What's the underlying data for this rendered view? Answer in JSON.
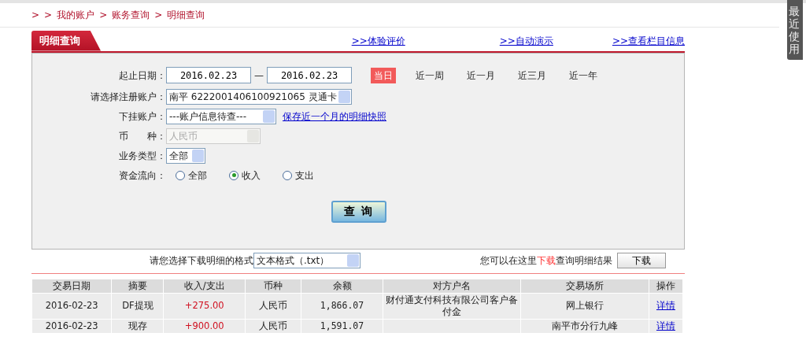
{
  "breadcrumb": {
    "prefix": ">",
    "separator": ">",
    "items": [
      "我的账户",
      "账务查询",
      "明细查询"
    ]
  },
  "side_tab": {
    "label": "最近使用"
  },
  "panel_tab": {
    "title": "明细查询"
  },
  "top_links": [
    {
      "arrow": ">>",
      "label": "体验评价"
    },
    {
      "arrow": ">>",
      "label": "自动演示"
    },
    {
      "arrow": ">>",
      "label": "查看栏目信息"
    }
  ],
  "form": {
    "date_label": "起止日期：",
    "date_from": "2016.02.23",
    "date_sep": "—",
    "date_to": "2016.02.23",
    "ranges": [
      {
        "label": "当日",
        "selected": true
      },
      {
        "label": "近一周",
        "selected": false
      },
      {
        "label": "近一月",
        "selected": false
      },
      {
        "label": "近三月",
        "selected": false
      },
      {
        "label": "近一年",
        "selected": false
      }
    ],
    "account_label": "请选择注册账户：",
    "account_value": "南平  6222001406100921065 灵通卡",
    "sub_label": "下挂账户：",
    "sub_value": "---账户信息待查---",
    "snapshot_link": "保存近一个月的明细快照",
    "currency_label": "币　　种：",
    "currency_value": "人民币",
    "currency_disabled": true,
    "type_label": "业务类型：",
    "type_value": "全部",
    "flow_label": "资金流向：",
    "flows": [
      {
        "label": "全部",
        "selected": false
      },
      {
        "label": "收入",
        "selected": true
      },
      {
        "label": "支出",
        "selected": false
      }
    ],
    "query_button": "查 询"
  },
  "download": {
    "label": "请您选择下载明细的格式",
    "format_value": "文本格式（.txt）",
    "hint_before": "您可以在这里",
    "hint_link": "下载",
    "hint_after": "查询明细结果",
    "button": "下载"
  },
  "table": {
    "columns": [
      "交易日期",
      "摘要",
      "收入/支出",
      "币种",
      "余额",
      "对方户名",
      "交易场所",
      "操作"
    ],
    "rows": [
      [
        "2016-02-23",
        "DF提现",
        "+275.00",
        "人民币",
        "1,866.07",
        "财付通支付科技有限公司客户备付金",
        "网上银行",
        "详情"
      ],
      [
        "2016-02-23",
        "现存",
        "+900.00",
        "人民币",
        "1,591.07",
        "",
        "南平市分行九峰",
        "详情"
      ]
    ]
  }
}
